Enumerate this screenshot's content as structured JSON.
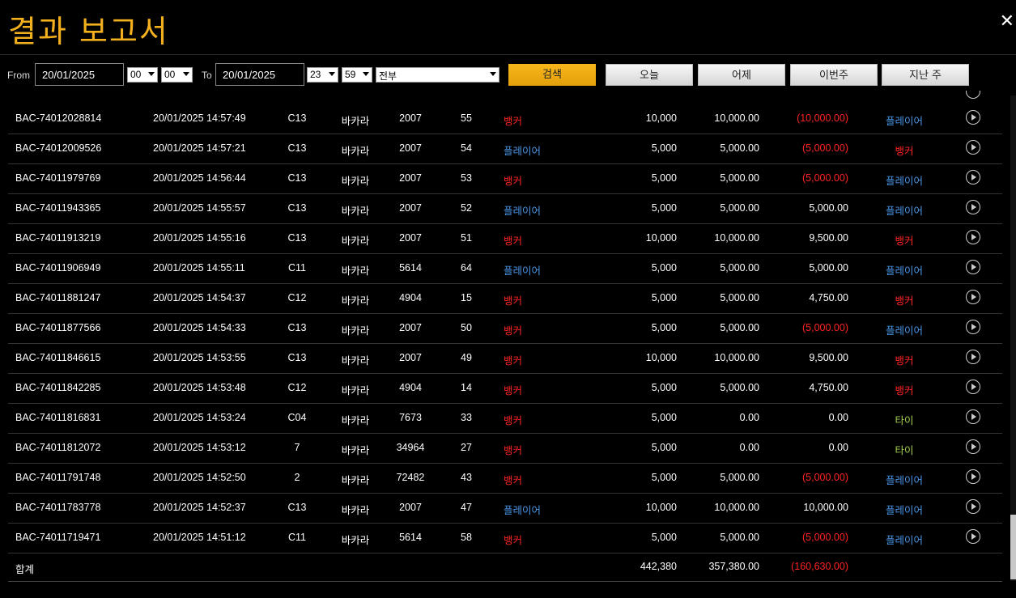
{
  "title": "결과 보고서",
  "filter": {
    "from_label": "From",
    "from_date": "20/01/2025",
    "from_hour": "00",
    "from_min": "00",
    "to_label": "To",
    "to_date": "20/01/2025",
    "to_hour": "23",
    "to_min": "59",
    "game_select": "전부",
    "search_label": "검색",
    "today_label": "오늘",
    "yesterday_label": "어제",
    "this_week_label": "이번주",
    "last_week_label": "지난 주"
  },
  "rows": [
    {
      "id": "BAC-74012028814",
      "datetime": "20/01/2025 14:57:49",
      "table": "C13",
      "game": "바카라",
      "round": "2007",
      "shoe": "55",
      "bet": "뱅커",
      "bet_color": "red",
      "amount": "10,000",
      "valid": "10,000.00",
      "winloss": "(10,000.00)",
      "winloss_neg": true,
      "result": "플레이어",
      "result_color": "blue"
    },
    {
      "id": "BAC-74012009526",
      "datetime": "20/01/2025 14:57:21",
      "table": "C13",
      "game": "바카라",
      "round": "2007",
      "shoe": "54",
      "bet": "플레이어",
      "bet_color": "blue",
      "amount": "5,000",
      "valid": "5,000.00",
      "winloss": "(5,000.00)",
      "winloss_neg": true,
      "result": "뱅커",
      "result_color": "red"
    },
    {
      "id": "BAC-74011979769",
      "datetime": "20/01/2025 14:56:44",
      "table": "C13",
      "game": "바카라",
      "round": "2007",
      "shoe": "53",
      "bet": "뱅커",
      "bet_color": "red",
      "amount": "5,000",
      "valid": "5,000.00",
      "winloss": "(5,000.00)",
      "winloss_neg": true,
      "result": "플레이어",
      "result_color": "blue"
    },
    {
      "id": "BAC-74011943365",
      "datetime": "20/01/2025 14:55:57",
      "table": "C13",
      "game": "바카라",
      "round": "2007",
      "shoe": "52",
      "bet": "플레이어",
      "bet_color": "blue",
      "amount": "5,000",
      "valid": "5,000.00",
      "winloss": "5,000.00",
      "winloss_neg": false,
      "result": "플레이어",
      "result_color": "blue"
    },
    {
      "id": "BAC-74011913219",
      "datetime": "20/01/2025 14:55:16",
      "table": "C13",
      "game": "바카라",
      "round": "2007",
      "shoe": "51",
      "bet": "뱅커",
      "bet_color": "red",
      "amount": "10,000",
      "valid": "10,000.00",
      "winloss": "9,500.00",
      "winloss_neg": false,
      "result": "뱅커",
      "result_color": "red"
    },
    {
      "id": "BAC-74011906949",
      "datetime": "20/01/2025 14:55:11",
      "table": "C11",
      "game": "바카라",
      "round": "5614",
      "shoe": "64",
      "bet": "플레이어",
      "bet_color": "blue",
      "amount": "5,000",
      "valid": "5,000.00",
      "winloss": "5,000.00",
      "winloss_neg": false,
      "result": "플레이어",
      "result_color": "blue"
    },
    {
      "id": "BAC-74011881247",
      "datetime": "20/01/2025 14:54:37",
      "table": "C12",
      "game": "바카라",
      "round": "4904",
      "shoe": "15",
      "bet": "뱅커",
      "bet_color": "red",
      "amount": "5,000",
      "valid": "5,000.00",
      "winloss": "4,750.00",
      "winloss_neg": false,
      "result": "뱅커",
      "result_color": "red"
    },
    {
      "id": "BAC-74011877566",
      "datetime": "20/01/2025 14:54:33",
      "table": "C13",
      "game": "바카라",
      "round": "2007",
      "shoe": "50",
      "bet": "뱅커",
      "bet_color": "red",
      "amount": "5,000",
      "valid": "5,000.00",
      "winloss": "(5,000.00)",
      "winloss_neg": true,
      "result": "플레이어",
      "result_color": "blue"
    },
    {
      "id": "BAC-74011846615",
      "datetime": "20/01/2025 14:53:55",
      "table": "C13",
      "game": "바카라",
      "round": "2007",
      "shoe": "49",
      "bet": "뱅커",
      "bet_color": "red",
      "amount": "10,000",
      "valid": "10,000.00",
      "winloss": "9,500.00",
      "winloss_neg": false,
      "result": "뱅커",
      "result_color": "red"
    },
    {
      "id": "BAC-74011842285",
      "datetime": "20/01/2025 14:53:48",
      "table": "C12",
      "game": "바카라",
      "round": "4904",
      "shoe": "14",
      "bet": "뱅커",
      "bet_color": "red",
      "amount": "5,000",
      "valid": "5,000.00",
      "winloss": "4,750.00",
      "winloss_neg": false,
      "result": "뱅커",
      "result_color": "red"
    },
    {
      "id": "BAC-74011816831",
      "datetime": "20/01/2025 14:53:24",
      "table": "C04",
      "game": "바카라",
      "round": "7673",
      "shoe": "33",
      "bet": "뱅커",
      "bet_color": "red",
      "amount": "5,000",
      "valid": "0.00",
      "winloss": "0.00",
      "winloss_neg": false,
      "result": "타이",
      "result_color": "green"
    },
    {
      "id": "BAC-74011812072",
      "datetime": "20/01/2025 14:53:12",
      "table": "7",
      "game": "바카라",
      "round": "34964",
      "shoe": "27",
      "bet": "뱅커",
      "bet_color": "red",
      "amount": "5,000",
      "valid": "0.00",
      "winloss": "0.00",
      "winloss_neg": false,
      "result": "타이",
      "result_color": "green"
    },
    {
      "id": "BAC-74011791748",
      "datetime": "20/01/2025 14:52:50",
      "table": "2",
      "game": "바카라",
      "round": "72482",
      "shoe": "43",
      "bet": "뱅커",
      "bet_color": "red",
      "amount": "5,000",
      "valid": "5,000.00",
      "winloss": "(5,000.00)",
      "winloss_neg": true,
      "result": "플레이어",
      "result_color": "blue"
    },
    {
      "id": "BAC-74011783778",
      "datetime": "20/01/2025 14:52:37",
      "table": "C13",
      "game": "바카라",
      "round": "2007",
      "shoe": "47",
      "bet": "플레이어",
      "bet_color": "blue",
      "amount": "10,000",
      "valid": "10,000.00",
      "winloss": "10,000.00",
      "winloss_neg": false,
      "result": "플레이어",
      "result_color": "blue"
    },
    {
      "id": "BAC-74011719471",
      "datetime": "20/01/2025 14:51:12",
      "table": "C11",
      "game": "바카라",
      "round": "5614",
      "shoe": "58",
      "bet": "뱅커",
      "bet_color": "red",
      "amount": "5,000",
      "valid": "5,000.00",
      "winloss": "(5,000.00)",
      "winloss_neg": true,
      "result": "플레이어",
      "result_color": "blue"
    }
  ],
  "total": {
    "label": "합계",
    "amount": "442,380",
    "valid": "357,380.00",
    "winloss": "(160,630.00)"
  },
  "colors": {
    "accent": "#f2b01e",
    "red": "#ff2323",
    "blue": "#4b97e8",
    "green": "#a3d050"
  },
  "icons": {
    "close": "close-icon",
    "play": "play-icon"
  }
}
